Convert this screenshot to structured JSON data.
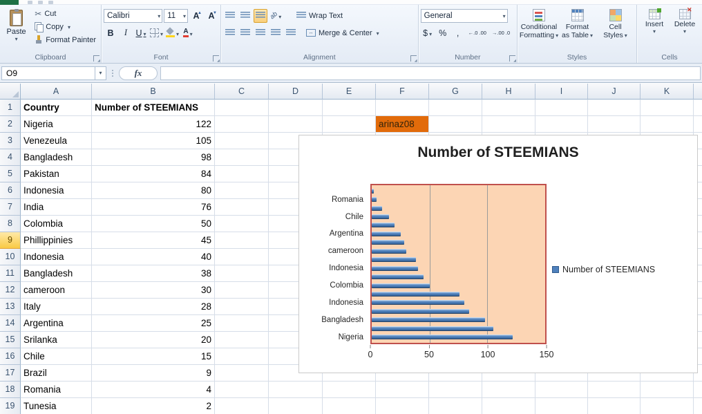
{
  "ribbon": {
    "clipboard": {
      "label": "Clipboard",
      "paste": "Paste",
      "cut": "Cut",
      "copy": "Copy",
      "format_painter": "Format Painter"
    },
    "font": {
      "label": "Font",
      "font_name": "Calibri",
      "font_size": "11",
      "bold": "B",
      "italic": "I",
      "underline": "U",
      "grow_font": "A",
      "shrink_font": "A"
    },
    "alignment": {
      "label": "Alignment",
      "wrap_text": "Wrap Text",
      "merge_center": "Merge & Center"
    },
    "number": {
      "label": "Number",
      "format": "General",
      "currency": "$",
      "percent": "%",
      "comma": ",",
      "increase_decimal": "←.0 .00",
      "decrease_decimal": "→.00 .0"
    },
    "styles": {
      "label": "Styles",
      "conditional_line1": "Conditional",
      "conditional_line2": "Formatting",
      "format_table_line1": "Format",
      "format_table_line2": "as Table",
      "cell_styles_line1": "Cell",
      "cell_styles_line2": "Styles"
    },
    "cells": {
      "label": "Cells",
      "insert": "Insert",
      "delete": "Delete"
    }
  },
  "formula_bar": {
    "name_box": "O9",
    "fx": "fx",
    "formula": ""
  },
  "grid": {
    "columns": [
      "A",
      "B",
      "C",
      "D",
      "E",
      "F",
      "G",
      "H",
      "I",
      "J",
      "K"
    ],
    "selected_row": 9,
    "f2_text": "arinaz08",
    "rows": [
      {
        "n": 1,
        "a": "Country",
        "b": "Number of STEEMIANS",
        "bold": true
      },
      {
        "n": 2,
        "a": "Nigeria",
        "b": "122"
      },
      {
        "n": 3,
        "a": "Venezeula",
        "b": "105"
      },
      {
        "n": 4,
        "a": "Bangladesh",
        "b": "98"
      },
      {
        "n": 5,
        "a": "Pakistan",
        "b": "84"
      },
      {
        "n": 6,
        "a": "Indonesia",
        "b": "80"
      },
      {
        "n": 7,
        "a": "India",
        "b": "76"
      },
      {
        "n": 8,
        "a": "Colombia",
        "b": "50"
      },
      {
        "n": 9,
        "a": "Phillippinies",
        "b": "45"
      },
      {
        "n": 10,
        "a": "Indonesia",
        "b": "40"
      },
      {
        "n": 11,
        "a": "Bangladesh",
        "b": "38"
      },
      {
        "n": 12,
        "a": "cameroon",
        "b": "30"
      },
      {
        "n": 13,
        "a": "Italy",
        "b": "28"
      },
      {
        "n": 14,
        "a": "Argentina",
        "b": "25"
      },
      {
        "n": 15,
        "a": "Srilanka",
        "b": "20"
      },
      {
        "n": 16,
        "a": "Chile",
        "b": "15"
      },
      {
        "n": 17,
        "a": "Brazil",
        "b": "9"
      },
      {
        "n": 18,
        "a": "Romania",
        "b": "4"
      },
      {
        "n": 19,
        "a": "Tunesia",
        "b": "2"
      }
    ]
  },
  "chart_data": {
    "type": "bar",
    "orientation": "horizontal",
    "title": "Number of STEEMIANS",
    "legend": [
      "Number of STEEMIANS"
    ],
    "legend_position": "right",
    "categories": [
      "Nigeria",
      "Venezeula",
      "Bangladesh",
      "Pakistan",
      "Indonesia",
      "India",
      "Colombia",
      "Phillippinies",
      "Indonesia",
      "Bangladesh",
      "cameroon",
      "Italy",
      "Argentina",
      "Srilanka",
      "Chile",
      "Brazil",
      "Romania",
      "Tunesia"
    ],
    "values": [
      122,
      105,
      98,
      84,
      80,
      76,
      50,
      45,
      40,
      38,
      30,
      28,
      25,
      20,
      15,
      9,
      4,
      2
    ],
    "xlim": [
      0,
      150
    ],
    "xticks": [
      0,
      50,
      100,
      150
    ],
    "category_label_interval": 2,
    "grid": true,
    "bar_color": "#4F81BD",
    "plot_bg": "#FCD5B4",
    "plot_border": "#C0504D"
  },
  "colors": {
    "excel_green": "#1E7145",
    "highlight_cell_orange": "#E26B0A",
    "selected_row_header": "#F9CA45",
    "bar_blue": "#4F81BD"
  },
  "icons": {
    "scissors": "✂",
    "dropdown_arrow": "▾"
  }
}
